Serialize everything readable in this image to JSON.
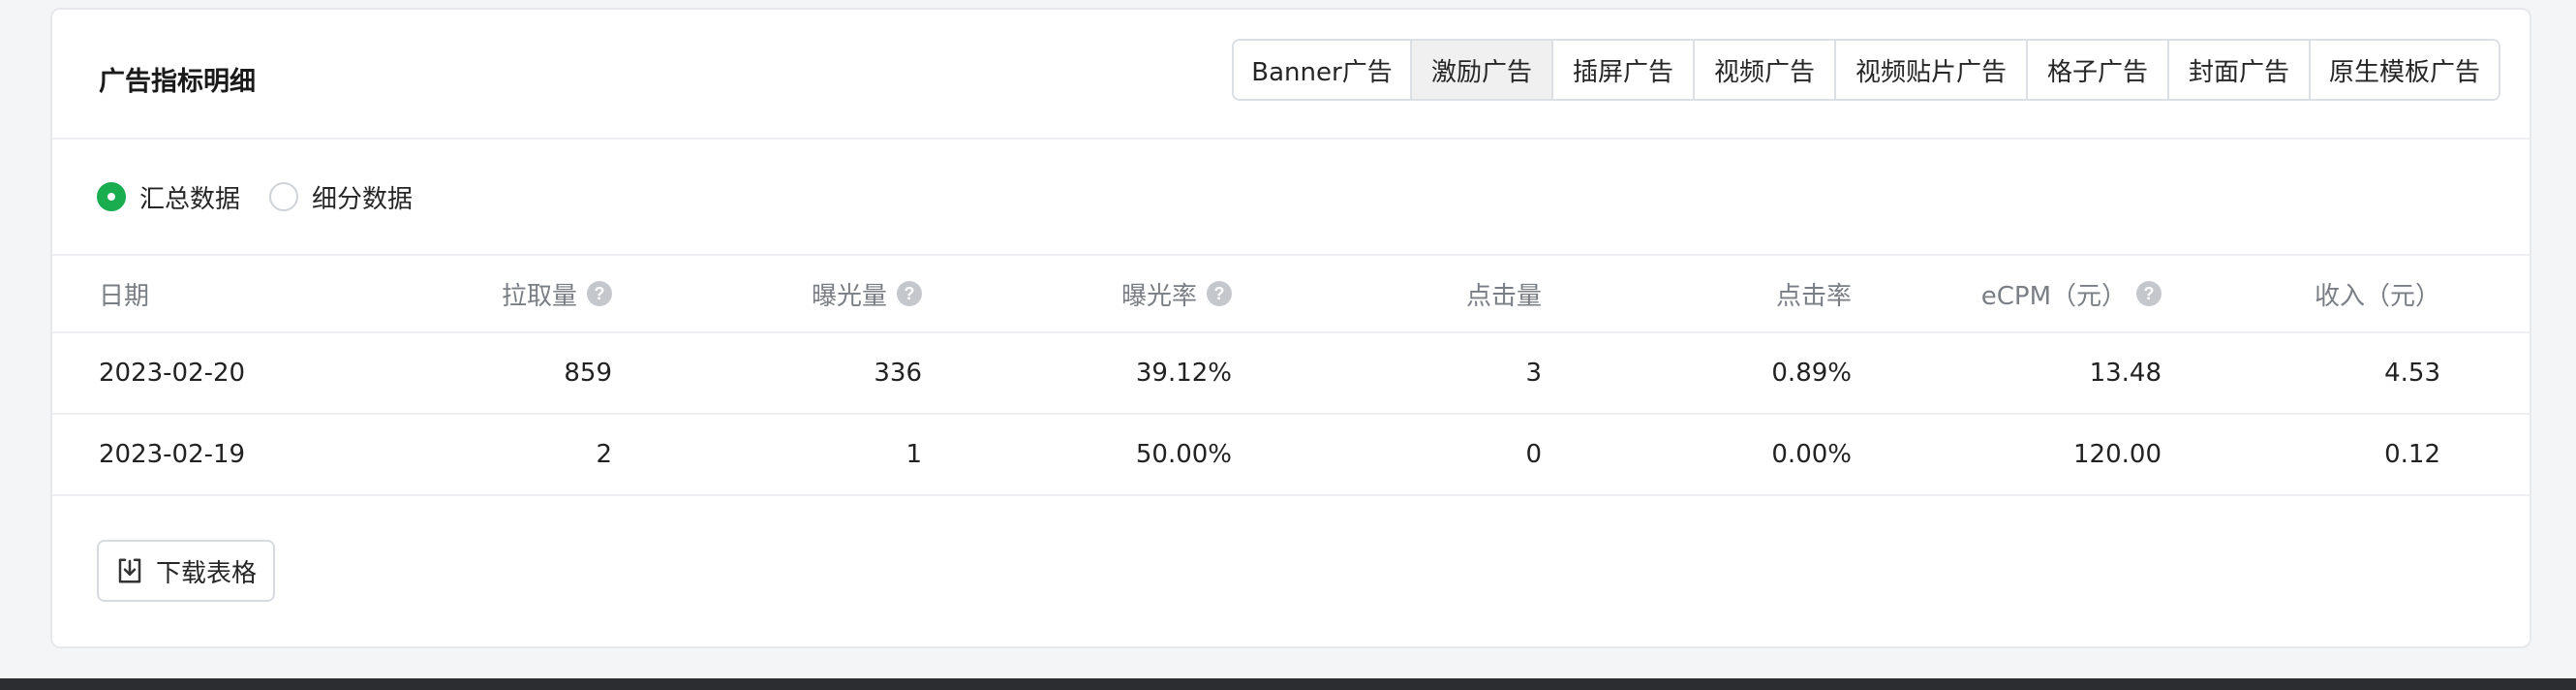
{
  "header": {
    "title": "广告指标明细",
    "tabs": [
      {
        "label": "Banner广告",
        "active": false
      },
      {
        "label": "激励广告",
        "active": true
      },
      {
        "label": "插屏广告",
        "active": false
      },
      {
        "label": "视频广告",
        "active": false
      },
      {
        "label": "视频贴片广告",
        "active": false
      },
      {
        "label": "格子广告",
        "active": false
      },
      {
        "label": "封面广告",
        "active": false
      },
      {
        "label": "原生模板广告",
        "active": false
      }
    ]
  },
  "view_mode": {
    "options": [
      {
        "label": "汇总数据",
        "checked": true
      },
      {
        "label": "细分数据",
        "checked": false
      }
    ]
  },
  "table": {
    "columns": [
      {
        "label": "日期",
        "help": false
      },
      {
        "label": "拉取量",
        "help": true
      },
      {
        "label": "曝光量",
        "help": true
      },
      {
        "label": "曝光率",
        "help": true
      },
      {
        "label": "点击量",
        "help": false
      },
      {
        "label": "点击率",
        "help": false
      },
      {
        "label": "eCPM（元）",
        "help": true
      },
      {
        "label": "收入（元）",
        "help": false
      }
    ],
    "rows": [
      [
        "2023-02-20",
        "859",
        "336",
        "39.12%",
        "3",
        "0.89%",
        "13.48",
        "4.53"
      ],
      [
        "2023-02-19",
        "2",
        "1",
        "50.00%",
        "0",
        "0.00%",
        "120.00",
        "0.12"
      ]
    ]
  },
  "footer": {
    "download_label": "下载表格"
  },
  "colors": {
    "accent": "#1aad4f",
    "border": "#dcdfe3",
    "header_text": "#7a7e85"
  }
}
